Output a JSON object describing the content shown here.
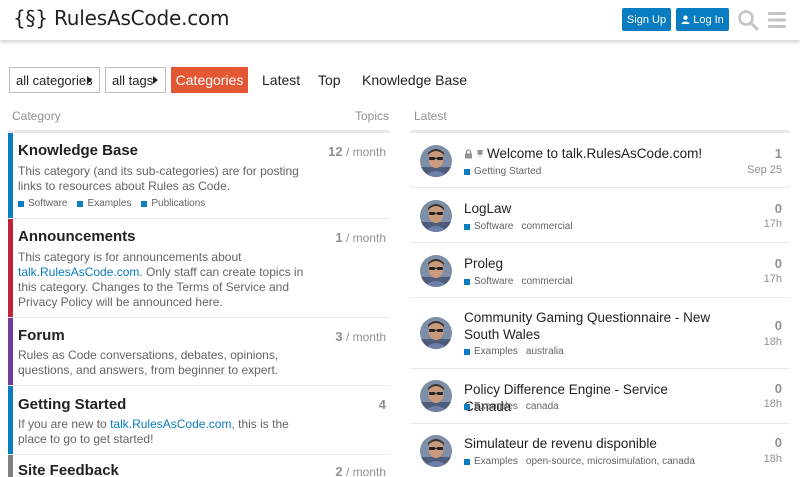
{
  "header": {
    "logo": "{§} RulesAsCode.com",
    "signup_label": "Sign Up",
    "login_label": "Log In"
  },
  "nav": {
    "categories_dropdown": "all categories",
    "tags_dropdown": "all tags",
    "tabs": [
      "Categories",
      "Latest",
      "Top",
      "Knowledge Base"
    ]
  },
  "columns": {
    "category": "Category",
    "topics": "Topics",
    "latest": "Latest"
  },
  "categories": [
    {
      "name": "Knowledge Base",
      "color": "#0a7cc1",
      "desc": "This category (and its sub-categories) are for posting links to resources about Rules as Code.",
      "count": "12",
      "period": "/ month",
      "subcats": [
        "Software",
        "Examples",
        "Publications"
      ]
    },
    {
      "name": "Announcements",
      "color": "#c0243c",
      "desc_pre": "This category is for announcements about ",
      "desc_link": "talk.RulesAsCode.com",
      "desc_post": ". Only staff can create topics in this category. Changes to the Terms of Service and Privacy Policy will be announced here.",
      "count": "1",
      "period": "/ month"
    },
    {
      "name": "Forum",
      "color": "#6f3a99",
      "desc": "Rules as Code conversations, debates, opinions, questions, and answers, from beginner to expert.",
      "count": "3",
      "period": "/ month"
    },
    {
      "name": "Getting Started",
      "color": "#0a7cc1",
      "desc_pre": "If you are new to ",
      "desc_link": "talk.RulesAsCode.com",
      "desc_post": ", this is the place to go to get started!",
      "count": "4",
      "period": ""
    },
    {
      "name": "Site Feedback",
      "color": "#808281",
      "count": "2",
      "period": "/ month"
    }
  ],
  "latest": [
    {
      "title": "Welcome to talk.RulesAsCode.com!",
      "category": "Getting Started",
      "tags": [],
      "count": "1",
      "age": "Sep 25",
      "pinned": true
    },
    {
      "title": "LogLaw",
      "category": "Software",
      "tags": [
        "commercial"
      ],
      "count": "0",
      "age": "17h"
    },
    {
      "title": "Proleg",
      "category": "Software",
      "tags": [
        "commercial"
      ],
      "count": "0",
      "age": "17h"
    },
    {
      "title": "Community Gaming Questionnaire - New South Wales",
      "category": "Examples",
      "tags": [
        "australia"
      ],
      "count": "0",
      "age": "18h"
    },
    {
      "title": "Policy Difference Engine - Service Canada",
      "category": "Examples",
      "tags": [
        "canada"
      ],
      "count": "0",
      "age": "18h"
    },
    {
      "title": "Simulateur de revenu disponible",
      "category": "Examples",
      "tags": [
        "open-source, microsimulation, canada"
      ],
      "count": "0",
      "age": "18h"
    }
  ],
  "icons": {
    "search": "search-icon",
    "menu": "hamburger-icon",
    "user": "user-icon",
    "lock": "lock-icon",
    "pin": "pin-icon"
  },
  "colors": {
    "accent": "#e45735",
    "primary": "#0a7cc1"
  }
}
